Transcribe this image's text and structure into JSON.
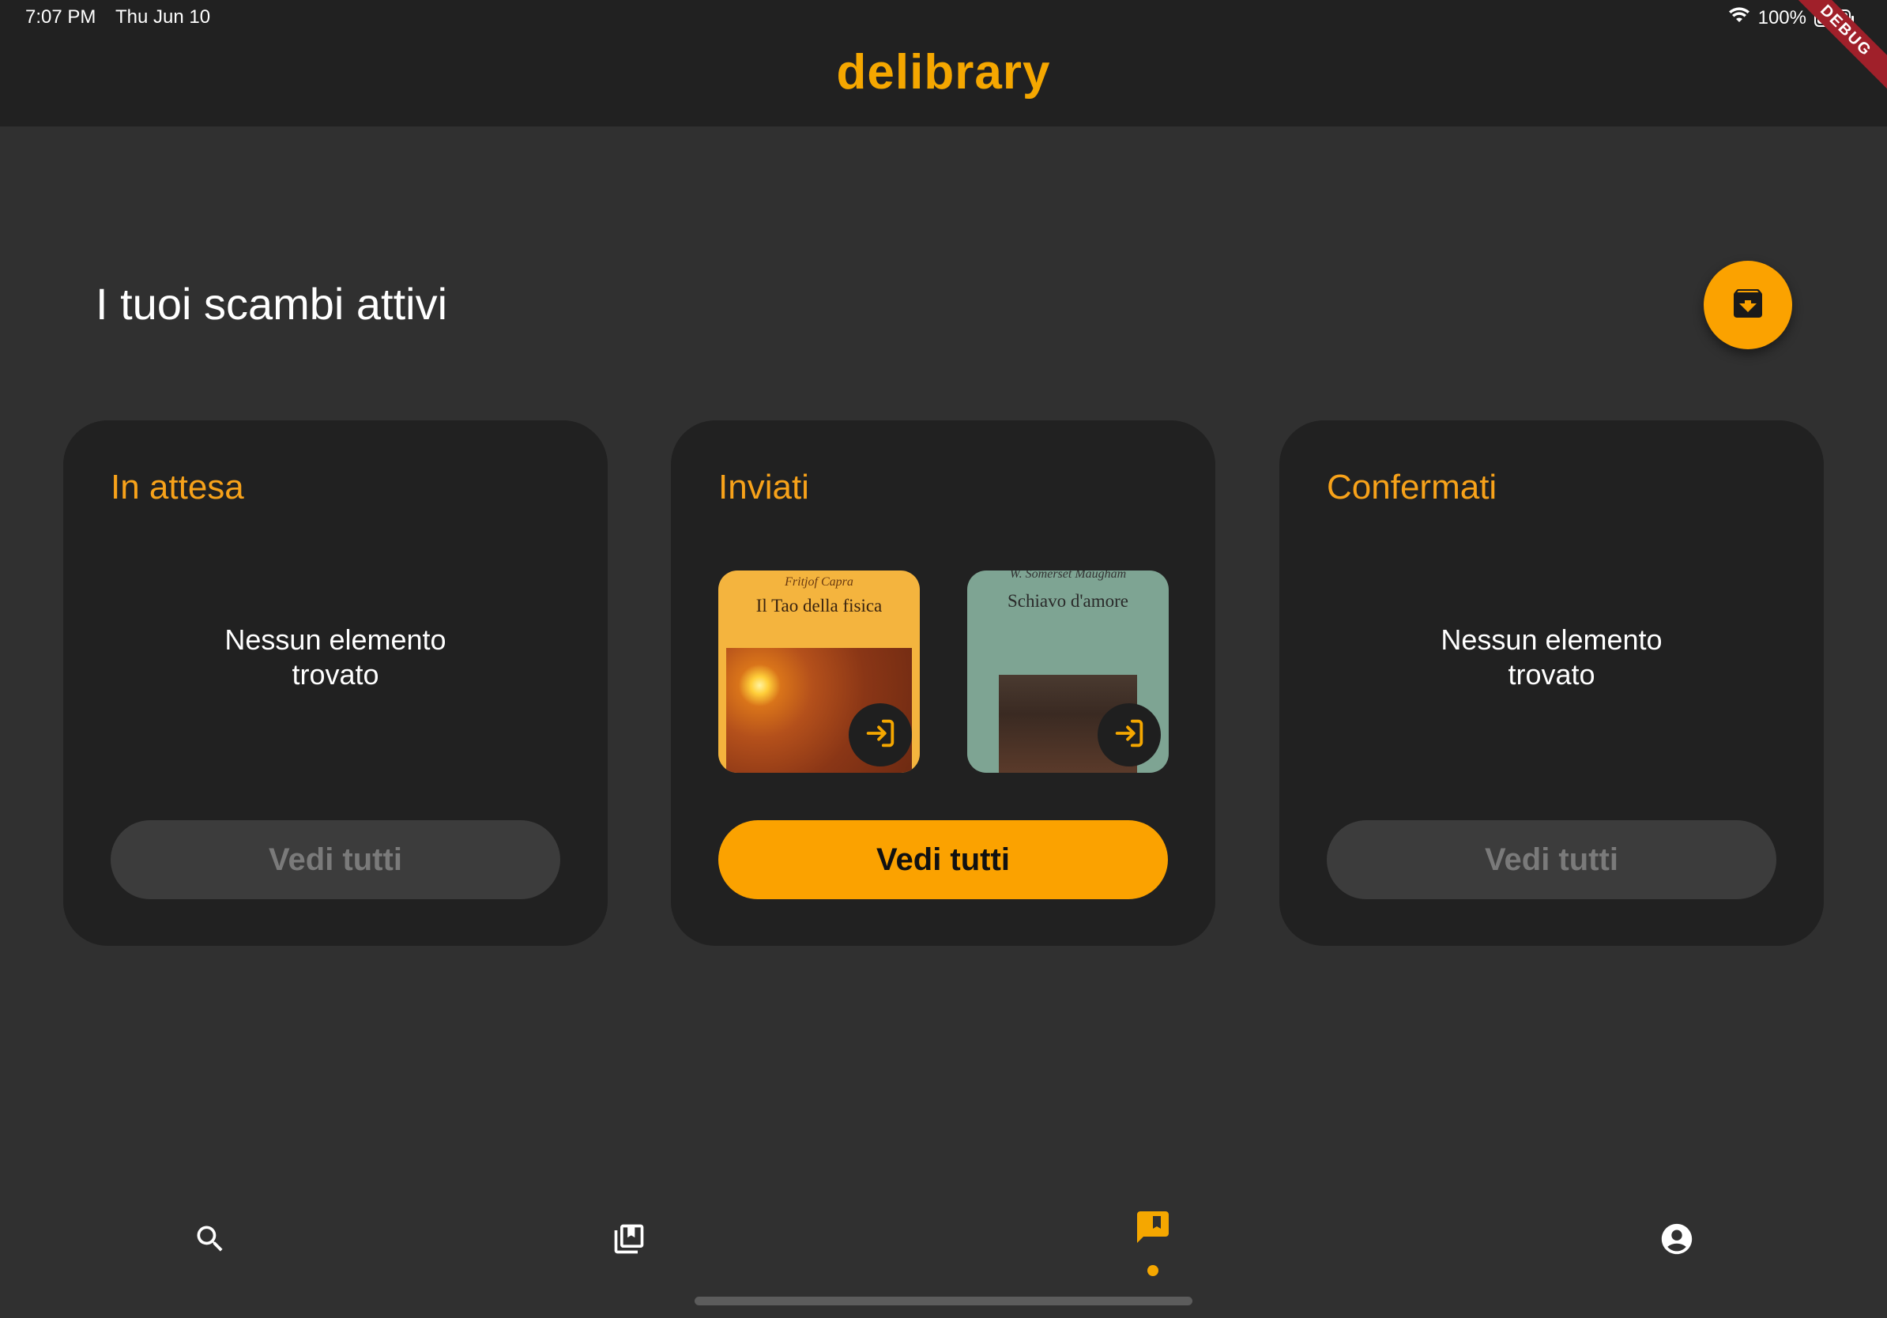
{
  "status_bar": {
    "time": "7:07 PM",
    "date": "Thu Jun 10",
    "battery": "100%",
    "debug_label": "DEBUG"
  },
  "app": {
    "title": "delibrary",
    "accent_color": "#f5a700"
  },
  "main": {
    "section_title": "I tuoi scambi attivi",
    "fab_icon": "archive-download-icon",
    "cards": [
      {
        "title": "In attesa",
        "empty_text": "Nessun elemento\ntrovato",
        "button_label": "Vedi tutti",
        "button_enabled": false
      },
      {
        "title": "Inviati",
        "button_label": "Vedi tutti",
        "button_enabled": true,
        "books": [
          {
            "author": "Fritjof Capra",
            "title": "Il Tao della fisica",
            "action_icon": "login-arrow-icon"
          },
          {
            "author": "W. Somerset Maugham",
            "title": "Schiavo d'amore",
            "action_icon": "login-arrow-icon"
          }
        ]
      },
      {
        "title": "Confermati",
        "empty_text": "Nessun elemento\ntrovato",
        "button_label": "Vedi tutti",
        "button_enabled": false
      }
    ]
  },
  "bottom_nav": {
    "items": [
      {
        "icon": "search-icon",
        "active": false
      },
      {
        "icon": "library-books-icon",
        "active": false
      },
      {
        "icon": "exchange-chat-icon",
        "active": true
      },
      {
        "icon": "account-circle-icon",
        "active": false
      }
    ]
  }
}
